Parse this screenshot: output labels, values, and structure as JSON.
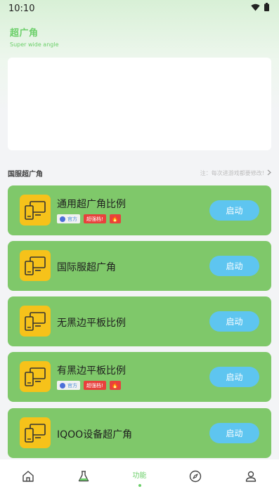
{
  "status_bar": {
    "time": "10:10",
    "icons": [
      "wifi-icon",
      "battery-icon"
    ]
  },
  "header": {
    "title": "超广角",
    "subtitle": "Super wide angle"
  },
  "section": {
    "title": "国服超广角",
    "note": "注：每次进游戏都要修改!"
  },
  "cards": [
    {
      "title": "通用超广角比例",
      "button": "启动",
      "tags": {
        "official": "官方",
        "hot": "超强档!",
        "fire": "🔥"
      }
    },
    {
      "title": "国际服超广角",
      "button": "启动"
    },
    {
      "title": "无黑边平板比例",
      "button": "启动"
    },
    {
      "title": "有黑边平板比例",
      "button": "启动",
      "tags": {
        "official": "官方",
        "hot": "超强档!",
        "fire": "🔥"
      }
    },
    {
      "title": "IQOO设备超广角",
      "button": "启动"
    }
  ],
  "nav": {
    "items": [
      {
        "icon": "home-icon",
        "label": ""
      },
      {
        "icon": "flask-icon",
        "label": ""
      },
      {
        "icon": "function-icon",
        "label": "功能",
        "active": true
      },
      {
        "icon": "compass-icon",
        "label": ""
      },
      {
        "icon": "user-icon",
        "label": ""
      }
    ]
  },
  "colors": {
    "accent": "#6ccf6a",
    "card": "#7fc86a",
    "button": "#5ec5f0",
    "icon_bg": "#f6c21a"
  }
}
